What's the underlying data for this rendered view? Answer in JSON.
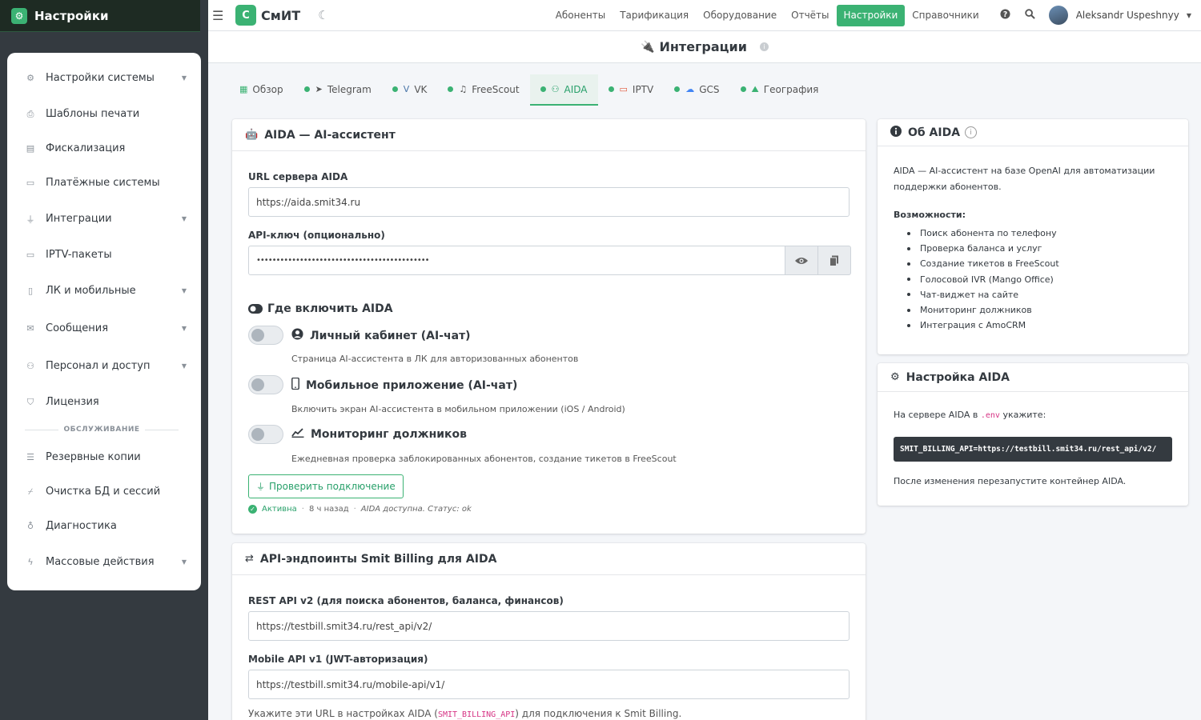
{
  "brand": {
    "title": "Настройки",
    "logo_icon": "gear-icon"
  },
  "sidebar": {
    "items": [
      {
        "label": "Настройки системы",
        "icon": "cogs-icon",
        "chevron": true
      },
      {
        "label": "Шаблоны печати",
        "icon": "print-icon",
        "chevron": false
      },
      {
        "label": "Фискализация",
        "icon": "cash-register-icon",
        "chevron": false
      },
      {
        "label": "Платёжные системы",
        "icon": "credit-card-icon",
        "chevron": false
      },
      {
        "label": "Интеграции",
        "icon": "plug-icon",
        "chevron": true
      },
      {
        "label": "IPTV-пакеты",
        "icon": "tv-icon",
        "chevron": false
      },
      {
        "label": "ЛК и мобильные",
        "icon": "mobile-icon",
        "chevron": true
      },
      {
        "label": "Сообщения",
        "icon": "envelope-icon",
        "chevron": true
      },
      {
        "label": "Персонал и доступ",
        "icon": "users-icon",
        "chevron": true
      },
      {
        "label": "Лицензия",
        "icon": "shield-icon",
        "chevron": false
      }
    ],
    "section_label": "ОБСЛУЖИВАНИЕ",
    "maint_items": [
      {
        "label": "Резервные копии",
        "icon": "database-icon",
        "chevron": false
      },
      {
        "label": "Очистка БД и сессий",
        "icon": "broom-icon",
        "chevron": false
      },
      {
        "label": "Диагностика",
        "icon": "stethoscope-icon",
        "chevron": false
      },
      {
        "label": "Массовые действия",
        "icon": "bolt-icon",
        "chevron": true
      }
    ]
  },
  "topbar": {
    "app_logo": "С",
    "app_name": "СмИТ",
    "nav": [
      "Абоненты",
      "Тарификация",
      "Оборудование",
      "Отчёты",
      "Настройки",
      "Справочники"
    ],
    "active_nav": "Настройки",
    "user_name": "Aleksandr Uspeshnyy"
  },
  "page": {
    "title": "Интеграции"
  },
  "tabs": [
    {
      "label": "Обзор",
      "icon": "table-icon",
      "dot": false,
      "active": false
    },
    {
      "label": "Telegram",
      "icon": "telegram-icon",
      "dot": true,
      "active": false
    },
    {
      "label": "VK",
      "icon": "vk-icon",
      "dot": true,
      "active": false
    },
    {
      "label": "FreeScout",
      "icon": "headset-icon",
      "dot": true,
      "active": false
    },
    {
      "label": "AIDA",
      "icon": "robot-icon",
      "dot": true,
      "active": true
    },
    {
      "label": "IPTV",
      "icon": "tv-icon",
      "dot": true,
      "active": false
    },
    {
      "label": "GCS",
      "icon": "cloud-icon",
      "dot": true,
      "active": false
    },
    {
      "label": "География",
      "icon": "map-icon",
      "dot": true,
      "active": false
    }
  ],
  "aida_card": {
    "title": "AIDA — AI-ассистент",
    "url_label": "URL сервера AIDA",
    "url_value": "https://aida.smit34.ru",
    "key_label": "API-ключ (опционально)",
    "key_value": "••••••••••••••••••••••••••••••••••••••••••••",
    "where_title": "Где включить AIDA",
    "toggles": [
      {
        "label": "Личный кабинет (AI-чат)",
        "desc": "Страница AI-ассистента в ЛК для авторизованных абонентов",
        "icon": "user-circle-icon",
        "on": false
      },
      {
        "label": "Мобильное приложение (AI-чат)",
        "desc": "Включить экран AI-ассистента в мобильном приложении (iOS / Android)",
        "icon": "mobile-icon",
        "on": false
      },
      {
        "label": "Мониторинг должников",
        "desc": "Ежедневная проверка заблокированных абонентов, создание тикетов в FreeScout",
        "icon": "chart-line-icon",
        "on": false
      }
    ],
    "test_button": "Проверить подключение",
    "status": {
      "active": "Активна",
      "time": "8 ч назад",
      "note": "AIDA доступна. Статус: ok"
    }
  },
  "api_card": {
    "title": "API-эндпоинты Smit Billing для AIDA",
    "rest_label": "REST API v2 (для поиска абонентов, баланса, финансов)",
    "rest_value": "https://testbill.smit34.ru/rest_api/v2/",
    "mobile_label": "Mobile API v1 (JWT-авторизация)",
    "mobile_value": "https://testbill.smit34.ru/mobile-api/v1/",
    "hint_before": "Укажите эти URL в настройках AIDA (",
    "hint_code": "SMIT_BILLING_API",
    "hint_after": ") для подключения к Smit Billing."
  },
  "about_card": {
    "title": "Об AIDA",
    "text": "AIDA — AI-ассистент на базе OpenAI для автоматизации поддержки абонентов.",
    "features_title": "Возможности:",
    "features": [
      "Поиск абонента по телефону",
      "Проверка баланса и услуг",
      "Создание тикетов в FreeScout",
      "Голосовой IVR (Mango Office)",
      "Чат-виджет на сайте",
      "Мониторинг должников",
      "Интеграция с AmoCRM"
    ]
  },
  "setup_card": {
    "title": "Настройка AIDA",
    "before": "На сервере AIDA в ",
    "env": ".env",
    "after": " укажите:",
    "code": "SMIT_BILLING_API=https://testbill.smit34.ru/rest_api/v2/",
    "footer": "После изменения перезапустите контейнер AIDA."
  },
  "colors": {
    "accent": "#3bb273",
    "sidebar_bg": "#343a40",
    "code_pink": "#d63384"
  }
}
